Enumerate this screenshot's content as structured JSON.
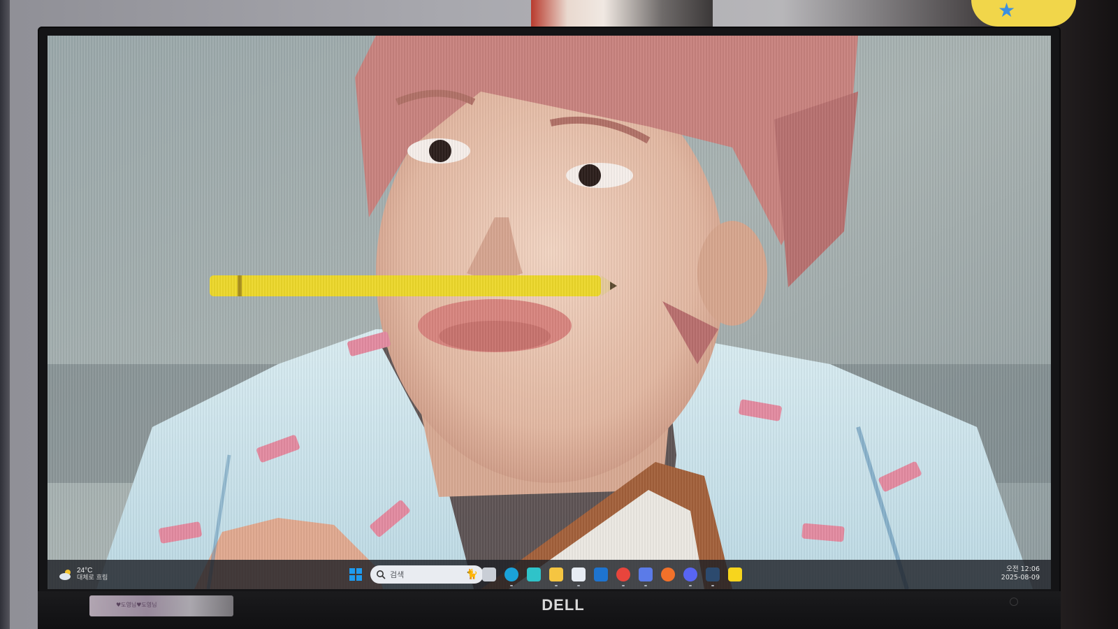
{
  "photo": {
    "desk_sticker_text": "♥도영님♥도영님"
  },
  "monitor": {
    "brand_logo": "DELL"
  },
  "wallpaper": {
    "subject": "person with pink hair holding a yellow pencil on upper lip"
  },
  "taskbar": {
    "weather": {
      "temperature": "24°C",
      "condition": "대체로 흐림",
      "icon": "cloud-sun-icon"
    },
    "start_icon": "windows-start-icon",
    "search": {
      "placeholder": "검색",
      "icon": "search-icon"
    },
    "pinned_apps": [
      {
        "name": "task-view",
        "icon": "task-view-icon",
        "color": "#c9ced6"
      },
      {
        "name": "edge",
        "icon": "edge-icon",
        "color": "#1aa2d9"
      },
      {
        "name": "bird-app",
        "icon": "bird-icon",
        "color": "#2fc3c9"
      },
      {
        "name": "file-explorer",
        "icon": "folder-icon",
        "color": "#f5c541"
      },
      {
        "name": "microsoft-store",
        "icon": "store-icon",
        "color": "#e7ecf3"
      },
      {
        "name": "outlook",
        "icon": "outlook-icon",
        "color": "#1e74d0"
      },
      {
        "name": "chrome",
        "icon": "chrome-icon",
        "color": "#e8453c"
      },
      {
        "name": "copilot",
        "icon": "copilot-icon",
        "color": "#5b7be8"
      },
      {
        "name": "firefox",
        "icon": "firefox-icon",
        "color": "#f1712a"
      },
      {
        "name": "discord",
        "icon": "discord-icon",
        "color": "#5865f2"
      },
      {
        "name": "steam",
        "icon": "steam-icon",
        "color": "#2c4a6e"
      },
      {
        "name": "kakaotalk",
        "icon": "kakaotalk-icon",
        "color": "#f7d51d"
      }
    ],
    "clock": {
      "time": "오전 12:06",
      "date": "2025-08-09"
    }
  }
}
